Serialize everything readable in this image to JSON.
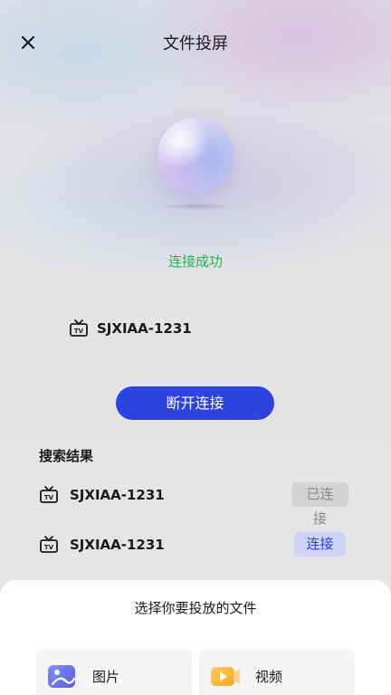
{
  "header": {
    "title": "文件投屏",
    "close_icon": "close-icon"
  },
  "connection": {
    "status": "连接成功",
    "status_color": "#2ab24e",
    "device_name": "SJXIAA-1231",
    "disconnect_label": "断开连接",
    "accent_color": "#2c43e0"
  },
  "search_results": {
    "title": "搜索结果",
    "items": [
      {
        "name": "SJXIAA-1231",
        "action": "已连接",
        "state": "connected"
      },
      {
        "name": "SJXIAA-1231",
        "action": "连接",
        "state": "available"
      }
    ]
  },
  "file_picker": {
    "title": "选择你要投放的文件",
    "options": [
      {
        "label": "图片",
        "icon": "image-icon"
      },
      {
        "label": "视频",
        "icon": "video-icon"
      }
    ]
  }
}
